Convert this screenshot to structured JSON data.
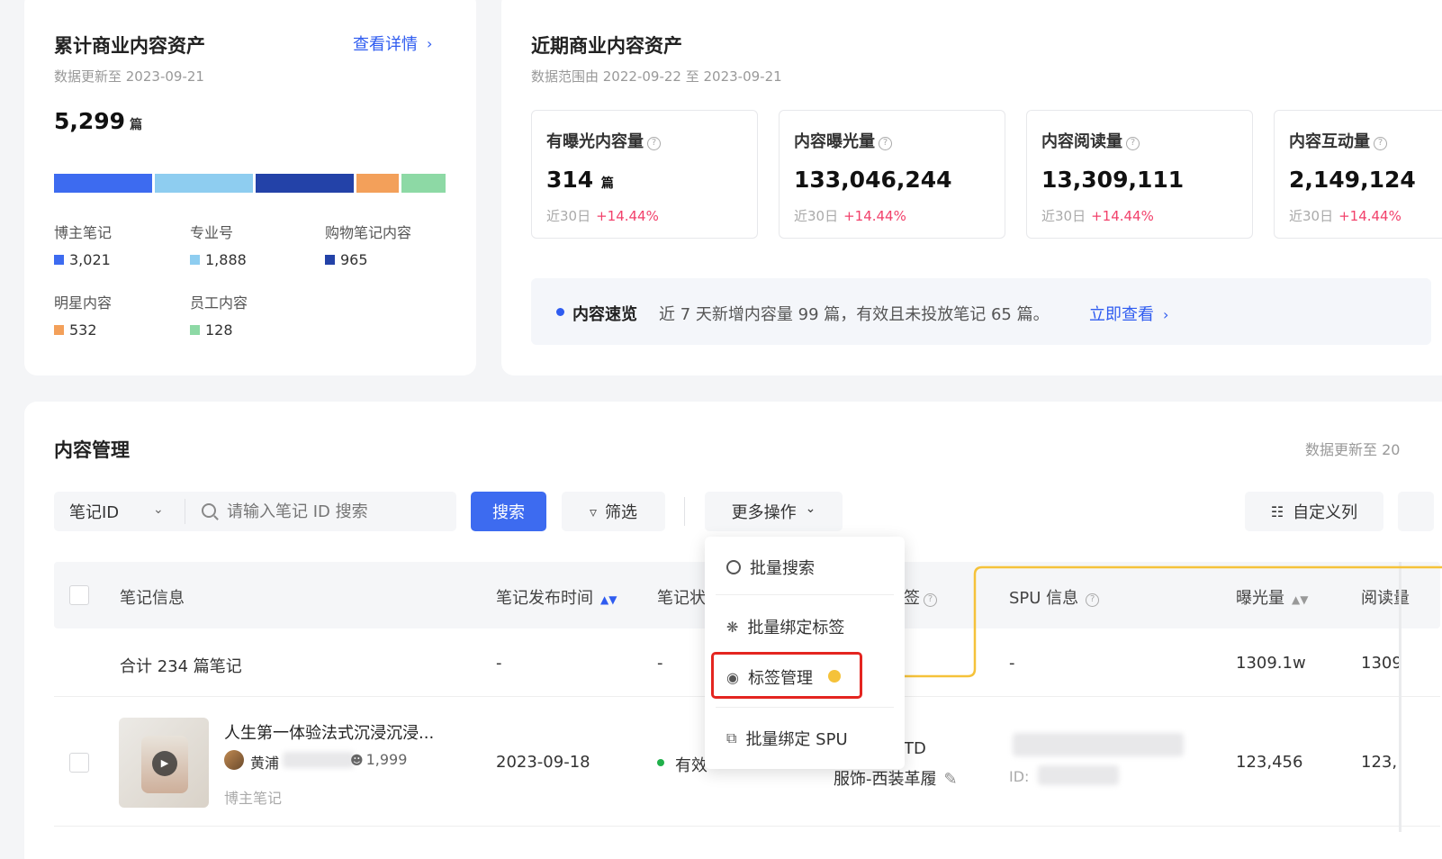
{
  "assets_total": {
    "title": "累计商业内容资产",
    "updated": "数据更新至 2023-09-21",
    "detail_link": "查看详情",
    "total": "5,299",
    "unit": "篇",
    "categories": [
      {
        "label": "博主笔记",
        "value": "3,021",
        "color": "#3d6bf0",
        "share": 0.25
      },
      {
        "label": "专业号",
        "value": "1,888",
        "color": "#8ecdf0",
        "share": 0.25
      },
      {
        "label": "购物笔记内容",
        "value": "965",
        "color": "#2342a8",
        "share": 0.25
      },
      {
        "label": "明星内容",
        "value": "532",
        "color": "#f3a05a",
        "share": 0.11
      },
      {
        "label": "员工内容",
        "value": "128",
        "color": "#8dd9a5",
        "share": 0.11
      }
    ]
  },
  "recent_assets": {
    "title": "近期商业内容资产",
    "range": "数据范围由 2022-09-22 至 2023-09-21",
    "metrics": [
      {
        "label": "有曝光内容量",
        "value": "314",
        "unit": "篇",
        "period": "近30日",
        "change": "+14.44%"
      },
      {
        "label": "内容曝光量",
        "value": "133,046,244",
        "unit": "",
        "period": "近30日",
        "change": "+14.44%"
      },
      {
        "label": "内容阅读量",
        "value": "13,309,111",
        "unit": "",
        "period": "近30日",
        "change": "+14.44%"
      },
      {
        "label": "内容互动量",
        "value": "2,149,124",
        "unit": "",
        "period": "近30日",
        "change": "+14.44%"
      }
    ],
    "overview": {
      "label": "内容速览",
      "text": "近 7 天新增内容量 99 篇，有效且未投放笔记 65 篇。",
      "link": "立即查看"
    }
  },
  "content_mgmt": {
    "title": "内容管理",
    "updated": "数据更新至 20",
    "id_select": "笔记ID",
    "search_placeholder": "请输入笔记 ID 搜索",
    "search_btn": "搜索",
    "filter_btn": "筛选",
    "more_btn": "更多操作",
    "custom_cols_btn": "自定义列",
    "dropdown": [
      "批量搜索",
      "批量绑定标签",
      "标签管理",
      "批量绑定 SPU"
    ],
    "columns": [
      "笔记信息",
      "笔记发布时间",
      "笔记状",
      "签",
      "SPU 信息",
      "曝光量",
      "阅读量"
    ],
    "total_row": {
      "label": "合计 234 篇笔记",
      "time": "-",
      "status": "-",
      "spu": "-",
      "exposure": "1309.1w",
      "read": "1309"
    },
    "rows": [
      {
        "title": "人生第一体验法式沉浸沉浸...",
        "author": "黄浦",
        "followers": "1,999",
        "type": "博主笔记",
        "time": "2023-09-18",
        "status": "有效",
        "tag_line1": "TD",
        "tag_line2": "服饰-西装革履",
        "spu_id": "ID:",
        "exposure": "123,456",
        "read": "123,"
      }
    ]
  }
}
